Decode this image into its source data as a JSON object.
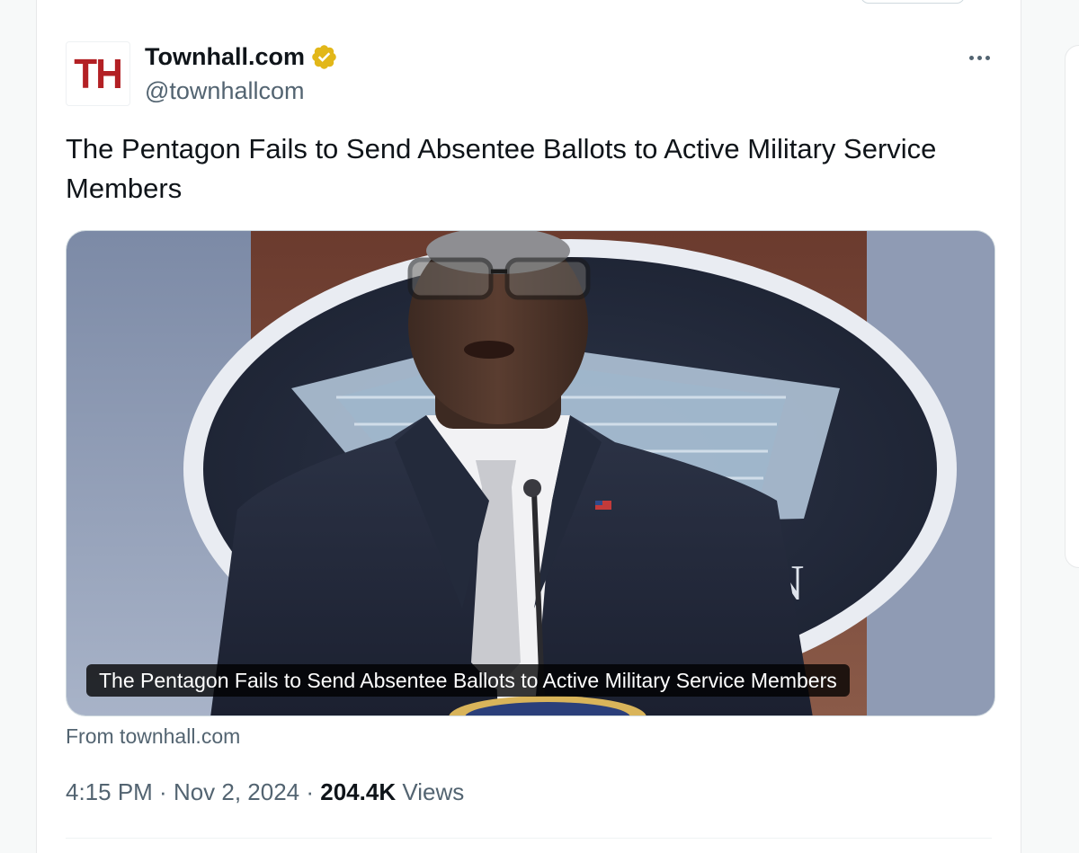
{
  "tweet": {
    "avatar_text": "TH",
    "display_name": "Townhall.com",
    "handle": "@townhallcom",
    "verified_icon": "gold-verified-badge",
    "more_icon": "more-horizontal-icon",
    "text": "The Pentagon Fails to Send Absentee Ballots to Active Military Service Members",
    "media": {
      "caption": "The Pentagon Fails to Send Absentee Ballots to Active Military Service Members"
    },
    "source": "From townhall.com",
    "time": "4:15 PM",
    "separator": " · ",
    "date": "Nov 2, 2024",
    "views_count": "204.4K",
    "views_label": " Views"
  },
  "colors": {
    "avatar_red": "#b32024",
    "verified_gold": "#e2b719",
    "secondary_text": "#536471",
    "primary_text": "#0f1419"
  }
}
